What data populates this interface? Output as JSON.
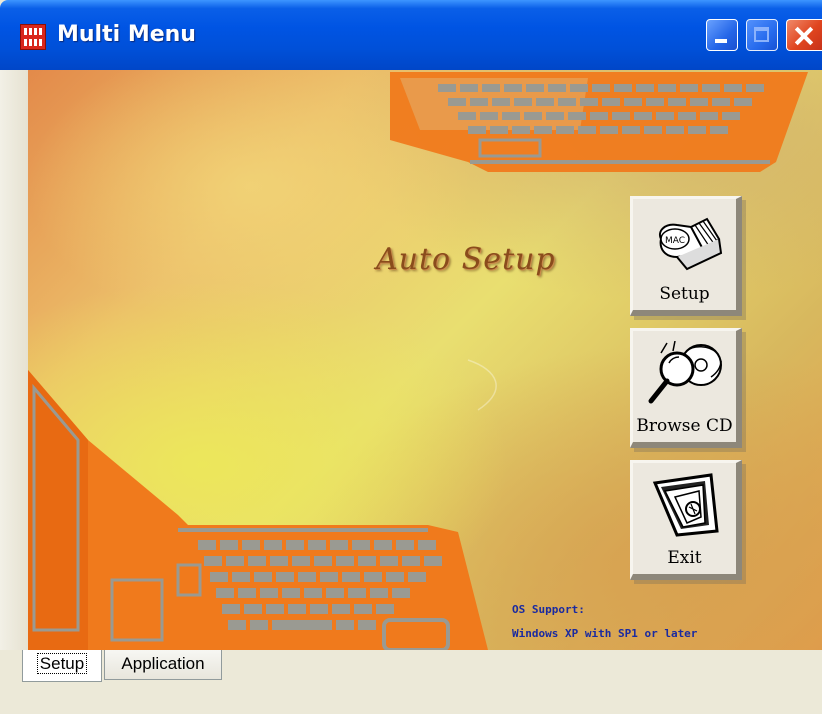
{
  "window": {
    "title": "Multi Menu",
    "buttons": [
      "minimize",
      "maximize",
      "close"
    ]
  },
  "main": {
    "heading": "Auto Setup",
    "buttons": [
      {
        "label": "Setup",
        "icon": "book-icon"
      },
      {
        "label": "Browse CD",
        "icon": "magnifier-cd-icon"
      },
      {
        "label": "Exit",
        "icon": "exit-door-icon"
      }
    ],
    "os_support": {
      "line1": "OS Support:",
      "line2": "Windows XP with SP1 or later"
    }
  },
  "tabs": [
    {
      "label": "Setup",
      "selected": true
    },
    {
      "label": "Application",
      "selected": false
    }
  ],
  "colors": {
    "titlebar": "#0054e3",
    "heading": "#8a4c1c",
    "os_support_text": "#1a2aa0",
    "laptop_art": "#f07a1c"
  }
}
